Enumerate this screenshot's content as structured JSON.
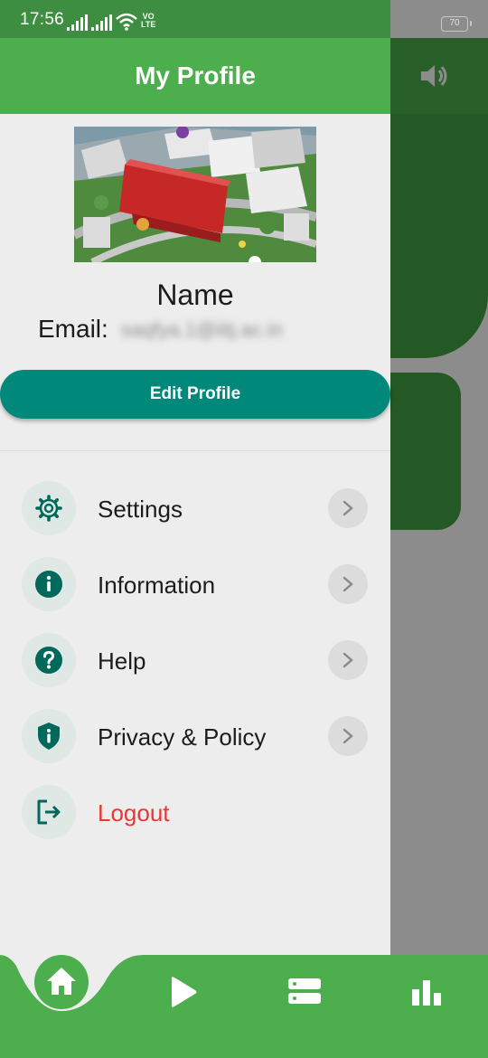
{
  "status_bar": {
    "time": "17:56",
    "network_label_top": "VO",
    "network_label_bottom": "LTE",
    "battery": "70"
  },
  "drawer": {
    "title": "My Profile",
    "profile": {
      "name": "Name",
      "email_label": "Email:",
      "email_value": "saqfya.1@iitj.ac.in",
      "edit_button_label": "Edit Profile"
    },
    "menu": [
      {
        "label": "Settings",
        "icon": "gear-icon"
      },
      {
        "label": "Information",
        "icon": "info-icon"
      },
      {
        "label": "Help",
        "icon": "question-icon"
      },
      {
        "label": "Privacy & Policy",
        "icon": "shield-icon"
      },
      {
        "label": "Logout",
        "icon": "logout-icon"
      }
    ]
  },
  "bottom_nav": [
    "home-icon",
    "play-icon",
    "servers-icon",
    "bar-chart-icon"
  ],
  "colors": {
    "primary_green": "#4cae4c",
    "status_green": "#3e8e41",
    "teal": "#00897b",
    "icon_teal": "#00695c",
    "logout_red": "#e53935"
  }
}
